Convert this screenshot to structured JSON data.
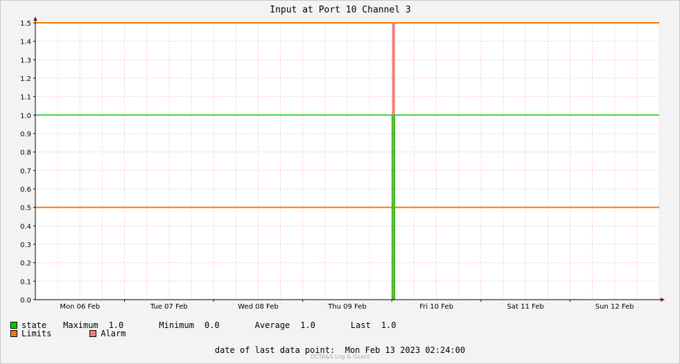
{
  "chart_data": {
    "type": "line",
    "title": "Input at Port 10 Channel 3",
    "ylim": [
      0,
      1.5
    ],
    "y_ticks": [
      "0.0",
      "0.1",
      "0.2",
      "0.3",
      "0.4",
      "0.5",
      "0.6",
      "0.7",
      "0.8",
      "0.9",
      "1.0",
      "1.1",
      "1.2",
      "1.3",
      "1.4",
      "1.5"
    ],
    "x_labels": [
      "Mon 06 Feb",
      "Tue 07 Feb",
      "Wed 08 Feb",
      "Thu 09 Feb",
      "Fri 10 Feb",
      "Sat 11 Feb",
      "Sun 12 Feb"
    ],
    "xlim_days": [
      "Mon 06 Feb 00:00",
      "Sun 12 Feb 24:00"
    ],
    "series": [
      {
        "name": "state",
        "color": "#00cc00",
        "points": [
          {
            "t": "Mon 06 Feb 00:00",
            "v": 1.0
          },
          {
            "t": "Fri 10 Feb 00:05",
            "v": 1.0
          },
          {
            "t": "Fri 10 Feb 00:05",
            "v": 0.0
          },
          {
            "t": "Fri 10 Feb 00:45",
            "v": 0.0
          },
          {
            "t": "Fri 10 Feb 00:45",
            "v": 1.0
          },
          {
            "t": "Sun 12 Feb 24:00",
            "v": 1.0
          }
        ]
      }
    ],
    "limits": {
      "name": "Limits",
      "color": "#ff7700",
      "values": [
        0.5,
        1.5
      ]
    },
    "alarm": {
      "name": "Alarm",
      "color": "#f08080",
      "start": "Fri 10 Feb 00:05",
      "end": "Fri 10 Feb 00:45"
    },
    "grid": true
  },
  "legend": {
    "state_label": "state",
    "maximum_label": "Maximum",
    "maximum_value": "1.0",
    "minimum_label": "Minimum",
    "minimum_value": "0.0",
    "average_label": "Average",
    "average_value": "1.0",
    "last_label": "Last",
    "last_value": "1.0",
    "limits_label": "Limits",
    "alarm_label": "Alarm",
    "state_color": "#00cc00",
    "limits_color": "#ff7700",
    "alarm_color": "#f08080"
  },
  "footer": {
    "date_label": "date of last data point:",
    "date_value": "Mon Feb 13 2023 02:24:00",
    "watermark": "OCTA&S Log & Guard"
  }
}
